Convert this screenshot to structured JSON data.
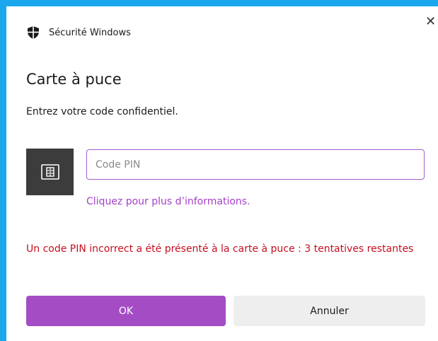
{
  "window": {
    "app_title": "Sécurité Windows",
    "close_glyph": "✕"
  },
  "dialog": {
    "title": "Carte à puce",
    "subtitle": "Entrez votre code confidentiel.",
    "pin_field": {
      "value": "",
      "placeholder": "Code PIN"
    },
    "info_link": "Cliquez pour plus d’informations.",
    "error_message": "Un code PIN incorrect a été présenté à la carte à puce : 3 tentatives restantes"
  },
  "buttons": {
    "ok_label": "OK",
    "cancel_label": "Annuler"
  },
  "icons": {
    "app": "shield-icon",
    "card": "smart-card-icon",
    "close": "close-icon"
  },
  "colors": {
    "accent": "#a44cc4",
    "link": "#a440c8",
    "error": "#c50f1f",
    "window_border": "#1aa7ee",
    "card_tile": "#3c3c3c"
  }
}
